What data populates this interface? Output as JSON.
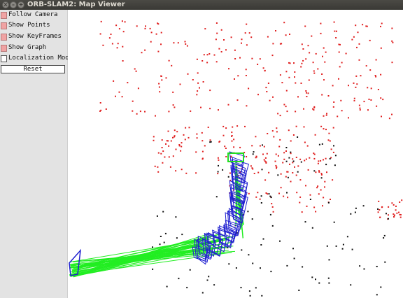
{
  "window": {
    "title": "ORB-SLAM2: Map Viewer"
  },
  "panel": {
    "options": [
      {
        "label": "Follow Camera",
        "checked": true
      },
      {
        "label": "Show Points",
        "checked": true
      },
      {
        "label": "Show KeyFrames",
        "checked": true
      },
      {
        "label": "Show Graph",
        "checked": true
      },
      {
        "label": "Localization Mode",
        "checked": false
      }
    ],
    "reset_label": "Reset"
  },
  "colors": {
    "map_points_reference": "#e02020",
    "map_points": "#111111",
    "keyframes": "#2020d0",
    "covisibility_graph": "#22ee22",
    "current_camera": "#22dd22",
    "checkbox_on": "#f0a3a3"
  }
}
